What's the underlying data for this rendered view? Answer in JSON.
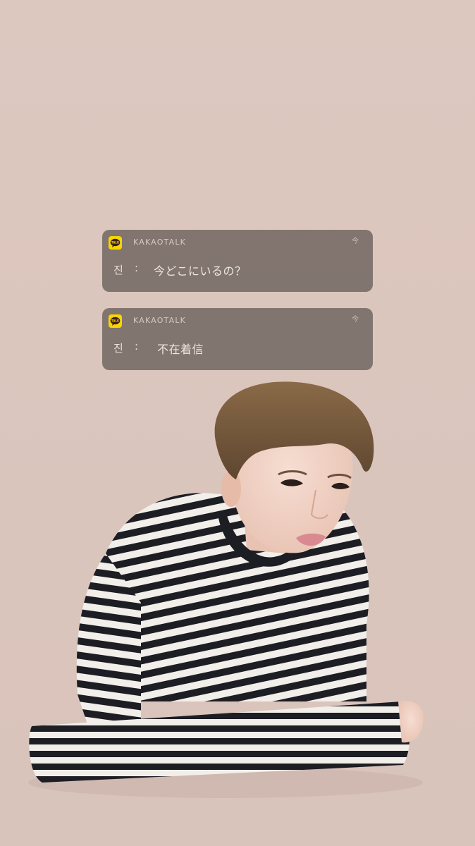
{
  "notifications": [
    {
      "app": "KAKAOTALK",
      "app_icon": "kakaotalk-icon",
      "icon_text": "TALK",
      "time": "今",
      "sender": "진",
      "separator": ":",
      "message": "今どこにいるの？"
    },
    {
      "app": "KAKAOTALK",
      "app_icon": "kakaotalk-icon",
      "icon_text": "TALK",
      "time": "今",
      "sender": "진",
      "separator": ":",
      "message": "不在着信"
    }
  ],
  "colors": {
    "background": "#dcc7bf",
    "notification_bg": "#7a6e68",
    "kakao_yellow": "#f7d600"
  }
}
